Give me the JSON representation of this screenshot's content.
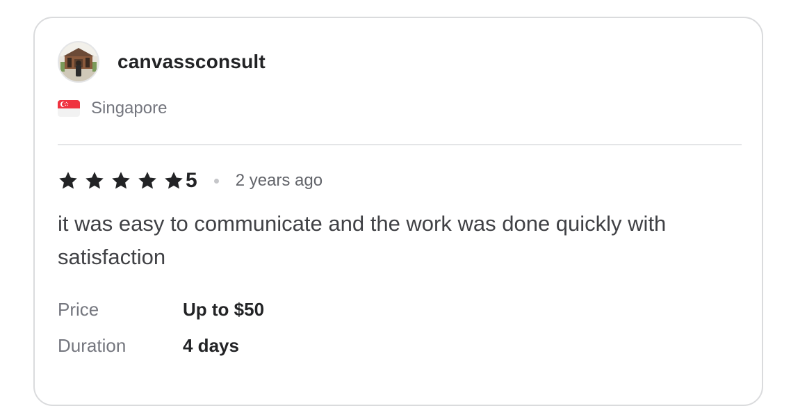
{
  "reviewer": {
    "username": "canvassconsult",
    "avatar_icon": "avatar-photo-temple",
    "country": "Singapore",
    "flag_icon": "singapore-flag-icon"
  },
  "review": {
    "rating": 5,
    "rating_label": "5",
    "stars_filled": 5,
    "time_ago": "2 years ago",
    "text": "it was easy to communicate and the work was done quickly with satisfaction"
  },
  "details": {
    "price_label": "Price",
    "price_value": "Up to $50",
    "duration_label": "Duration",
    "duration_value": "4 days"
  },
  "colors": {
    "border": "#dadbdd",
    "star": "#222325",
    "muted_text": "#74767e",
    "flag_red": "#ef3340"
  }
}
